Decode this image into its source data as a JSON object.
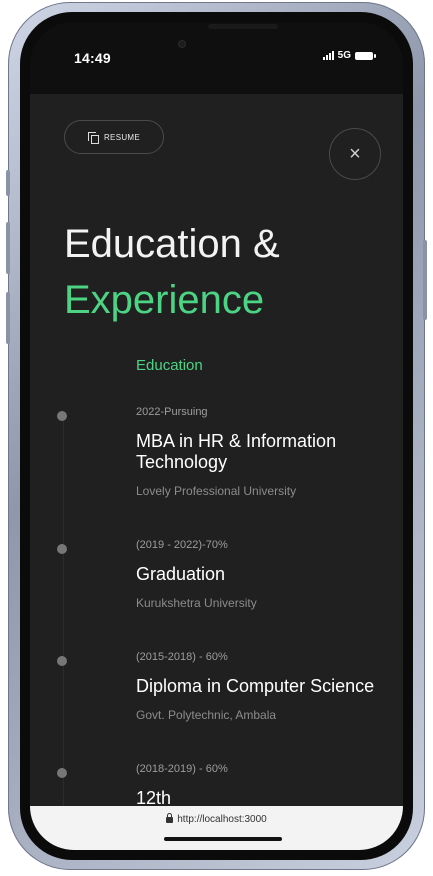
{
  "status_bar": {
    "time": "14:49",
    "network": "5G"
  },
  "header": {
    "resume_label": "RESUME",
    "close_label": "×",
    "title_line1": "Education &",
    "title_line2": "Experience"
  },
  "section": {
    "label": "Education"
  },
  "entries": [
    {
      "period": "2022-Pursuing",
      "title": "MBA in HR & Information Technology",
      "institution": "Lovely Professional University"
    },
    {
      "period": "(2019 - 2022)-70%",
      "title": "Graduation",
      "institution": "Kurukshetra University"
    },
    {
      "period": "(2015-2018) - 60%",
      "title": "Diploma in Computer Science",
      "institution": "Govt. Polytechnic, Ambala"
    },
    {
      "period": "(2018-2019) - 60%",
      "title": "12th",
      "institution": ""
    }
  ],
  "browser": {
    "url": "http://localhost:3000"
  },
  "colors": {
    "accent": "#4cd484",
    "background": "#202020"
  },
  "icons": {
    "resume": "copy-icon",
    "close": "close-icon",
    "url": "lock-icon"
  }
}
